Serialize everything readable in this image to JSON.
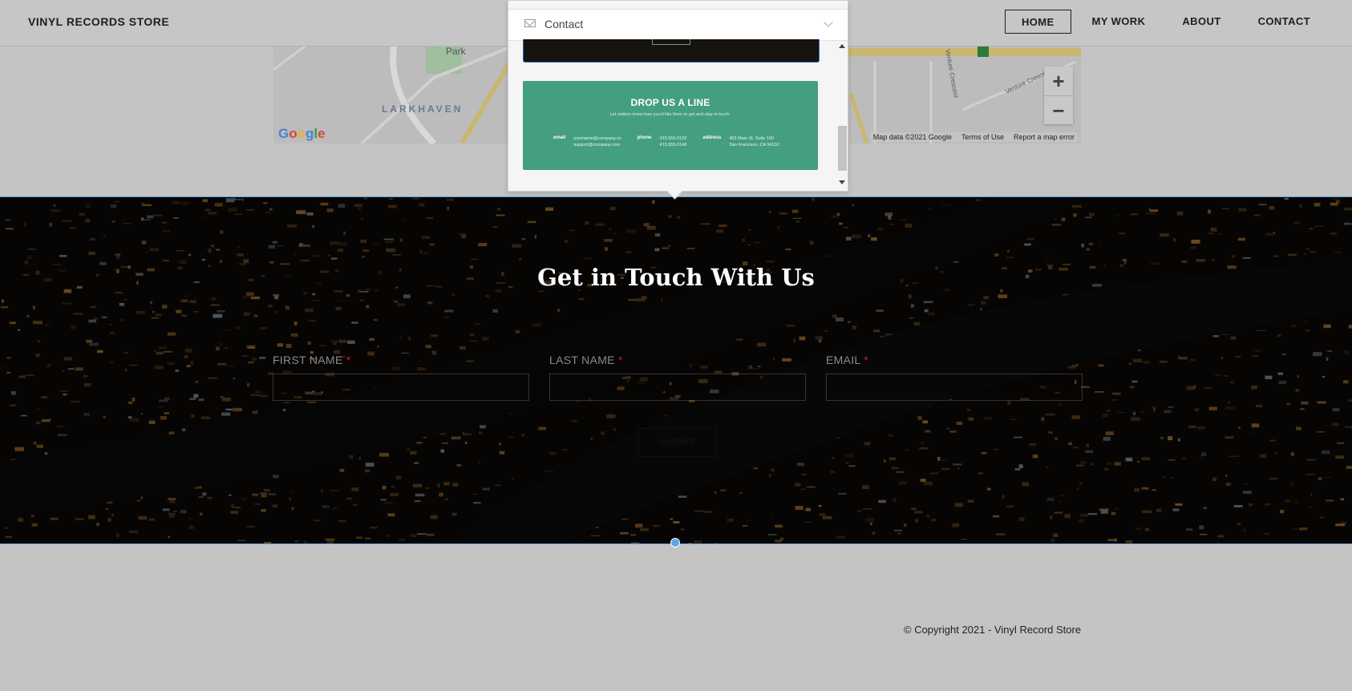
{
  "nav": {
    "brand": "VINYL RECORDS STORE",
    "links": [
      "HOME",
      "MY WORK",
      "ABOUT",
      "CONTACT"
    ],
    "active": "HOME"
  },
  "map": {
    "labels": {
      "park": "Park",
      "district": "LARKHAVEN",
      "street1": "Venture Crescent",
      "street2": "Venture Crescent"
    },
    "logo": "Google",
    "attribution": [
      "Map data ©2021 Google",
      "Terms of Use",
      "Report a map error"
    ],
    "zoom_in": "+",
    "zoom_out": "−"
  },
  "popup": {
    "title": "Contact",
    "card": {
      "heading": "DROP US A LINE",
      "subtitle": "Let visitors know how you'd like them to get and stay in touch.",
      "email_label": "email",
      "email_values": [
        "yourname@company.co",
        "support@company.com"
      ],
      "phone_label": "phone",
      "phone_values": [
        "415.555.0120",
        "415.555.0148"
      ],
      "address_label": "address",
      "address_values": [
        "453 Main St. Suite 100",
        "San Francisco, CA 94132"
      ]
    }
  },
  "hero": {
    "title": "Get in Touch With Us",
    "fields": [
      {
        "label": "FIRST NAME",
        "required": "*"
      },
      {
        "label": "LAST NAME",
        "required": "*"
      },
      {
        "label": "EMAIL",
        "required": "*"
      }
    ],
    "submit_label": "SUBMIT"
  },
  "footer": {
    "copyright": "© Copyright 2021 - Vinyl Record Store"
  },
  "colors": {
    "card_green": "#449e80",
    "selection_blue": "#5aa5e6",
    "page_bg": "#c4c4c4"
  }
}
